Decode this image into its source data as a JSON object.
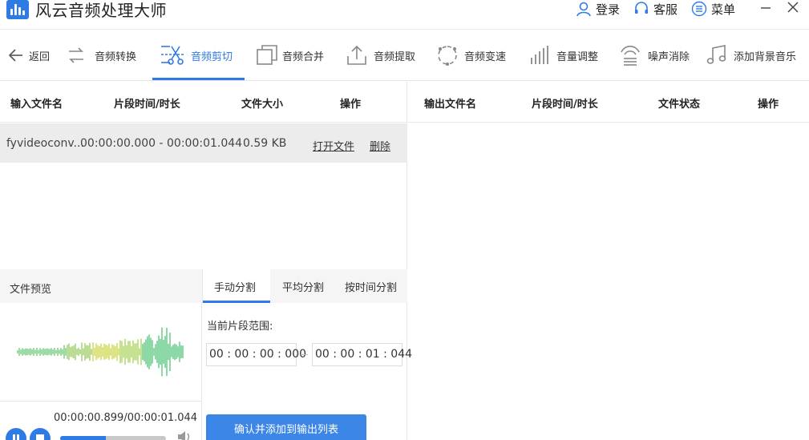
{
  "app": {
    "title": "风云音频处理大师"
  },
  "titlebar": {
    "login": "登录",
    "service": "客服",
    "menu": "菜单"
  },
  "toolbar": {
    "back": "返回",
    "tools": [
      "音频转换",
      "音频剪切",
      "音频合并",
      "音频提取",
      "音频变速",
      "音量调整",
      "噪声消除",
      "添加背景音乐"
    ],
    "active": "音频剪切"
  },
  "input_table": {
    "headers": [
      "输入文件名",
      "片段时间/时长",
      "文件大小",
      "操作"
    ],
    "rows": [
      {
        "name": "fyvideoconv...",
        "range": "00:00:00.000 - 00:00:01.044",
        "size": "0.59 KB",
        "open": "打开文件",
        "delete": "删除"
      }
    ]
  },
  "output_table": {
    "headers": [
      "输出文件名",
      "片段时间/时长",
      "文件状态",
      "操作"
    ]
  },
  "preview": {
    "label": "文件预览",
    "time": "00:00:00.899/00:00:01.044",
    "progress": 0.43
  },
  "split": {
    "tabs": [
      "手动分割",
      "平均分割",
      "按时间分割"
    ],
    "active_tab": "手动分割",
    "range_label": "当前片段范围:",
    "start": "00 : 00 : 00 : 000",
    "end": "00 : 00 : 01 : 044",
    "confirm": "确认并添加到输出列表"
  },
  "colors": {
    "accent": "#2f7be6",
    "button": "#3c86e8",
    "row_bg": "#ececec"
  }
}
